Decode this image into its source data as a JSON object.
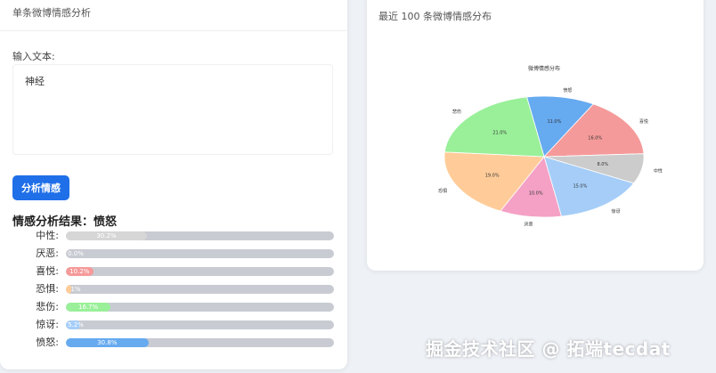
{
  "left_panel": {
    "header_title": "单条微博情感分析",
    "input_label": "输入文本:",
    "input_value": "神经",
    "analyze_button": "分析情感",
    "result_title": "情感分析结果：愤怒",
    "emotions": [
      {
        "label": "中性:",
        "value": 30.2,
        "pct_text": "30.2%",
        "color": "#d6d6d6"
      },
      {
        "label": "厌恶:",
        "value": 0.0,
        "pct_text": "0.0%",
        "color": "#f4a1c5"
      },
      {
        "label": "喜悦:",
        "value": 10.2,
        "pct_text": "10.2%",
        "color": "#f59a9a"
      },
      {
        "label": "恐惧:",
        "value": 1.2,
        "pct_text": "1%",
        "color": "#ffcc99"
      },
      {
        "label": "悲伤:",
        "value": 16.7,
        "pct_text": "16.7%",
        "color": "#99f099"
      },
      {
        "label": "惊讶:",
        "value": 5.2,
        "pct_text": "5.2%",
        "color": "#a5cdf8"
      },
      {
        "label": "愤怒:",
        "value": 30.8,
        "pct_text": "30.8%",
        "color": "#66aaf0"
      }
    ]
  },
  "right_panel": {
    "title": "最近 100 条微博情感分布"
  },
  "chart_data": {
    "type": "pie",
    "title": "微博情感分布",
    "slices": [
      {
        "label": "愤怒",
        "value": 11.0,
        "pct_text": "11.0%",
        "color": "#66aaf0"
      },
      {
        "label": "喜悦",
        "value": 16.0,
        "pct_text": "16.0%",
        "color": "#f59a9a"
      },
      {
        "label": "中性",
        "value": 8.0,
        "pct_text": "8.0%",
        "color": "#cccccc"
      },
      {
        "label": "惊讶",
        "value": 15.0,
        "pct_text": "15.0%",
        "color": "#a5cdf8"
      },
      {
        "label": "厌恶",
        "value": 10.0,
        "pct_text": "10.0%",
        "color": "#f4a1c5"
      },
      {
        "label": "恐惧",
        "value": 19.0,
        "pct_text": "19.0%",
        "color": "#ffcc99"
      },
      {
        "label": "悲伤",
        "value": 21.0,
        "pct_text": "21.0%",
        "color": "#99f099"
      }
    ]
  },
  "watermark": "掘金技术社区 @ 拓端tecdat"
}
